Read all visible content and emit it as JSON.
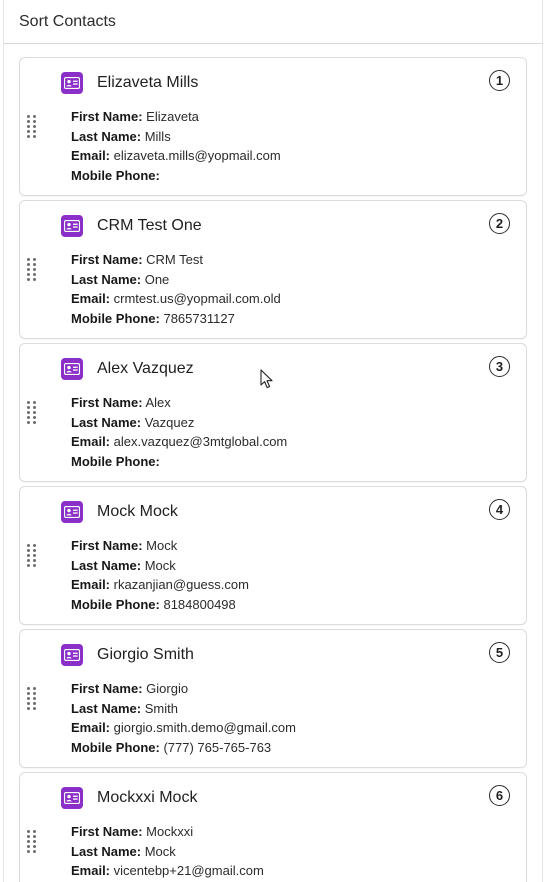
{
  "header": {
    "title": "Sort Contacts"
  },
  "labels": {
    "first_name": "First Name:",
    "last_name": "Last Name:",
    "email": "Email:",
    "mobile_phone": "Mobile Phone:"
  },
  "contacts": [
    {
      "name": "Elizaveta Mills",
      "order": "1",
      "first_name": "Elizaveta",
      "last_name": "Mills",
      "email": "elizaveta.mills@yopmail.com",
      "mobile_phone": ""
    },
    {
      "name": "CRM Test One",
      "order": "2",
      "first_name": "CRM Test",
      "last_name": "One",
      "email": "crmtest.us@yopmail.com.old",
      "mobile_phone": "7865731127"
    },
    {
      "name": "Alex Vazquez",
      "order": "3",
      "first_name": "Alex",
      "last_name": "Vazquez",
      "email": "alex.vazquez@3mtglobal.com",
      "mobile_phone": ""
    },
    {
      "name": "Mock Mock",
      "order": "4",
      "first_name": "Mock",
      "last_name": "Mock",
      "email": "rkazanjian@guess.com",
      "mobile_phone": "8184800498"
    },
    {
      "name": "Giorgio Smith",
      "order": "5",
      "first_name": "Giorgio",
      "last_name": "Smith",
      "email": "giorgio.smith.demo@gmail.com",
      "mobile_phone": "(777) 765-765-763"
    },
    {
      "name": "Mockxxi Mock",
      "order": "6",
      "first_name": "Mockxxi",
      "last_name": "Mock",
      "email": "vicentebp+21@gmail.com",
      "mobile_phone": ""
    }
  ],
  "icons": {
    "contact": "contact-card-icon",
    "drag": "drag-handle-icon",
    "cursor": "mouse-pointer-icon"
  },
  "colors": {
    "contact_icon_bg": "#8b2fc9",
    "border": "#dddbda"
  }
}
